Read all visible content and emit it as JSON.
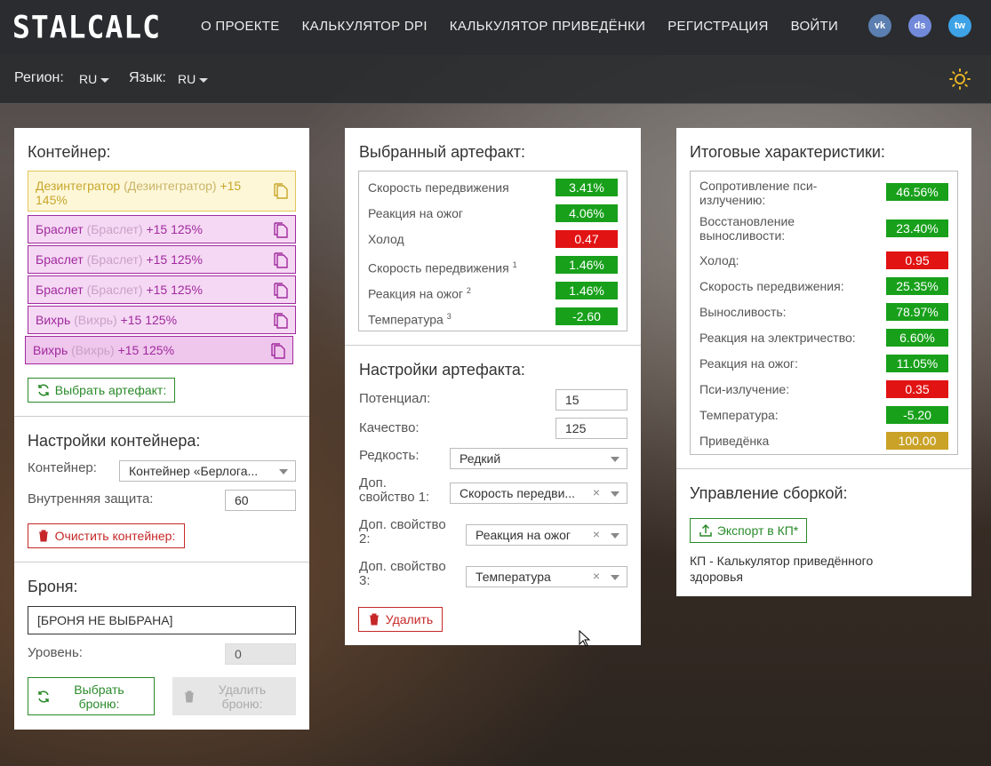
{
  "nav": {
    "logo": "STALCALC",
    "links": [
      "О ПРОЕКТЕ",
      "КАЛЬКУЛЯТОР DPI",
      "КАЛЬКУЛЯТОР ПРИВЕДЁНКИ",
      "РЕГИСТРАЦИЯ",
      "ВОЙТИ"
    ],
    "social": [
      {
        "icon": "vk-icon",
        "text": "vk",
        "color": "#5b7fb0"
      },
      {
        "icon": "discord-icon",
        "text": "ds",
        "color": "#7289da"
      },
      {
        "icon": "twitter-icon",
        "text": "tw",
        "color": "#3da2e6"
      }
    ]
  },
  "subbar": {
    "region_label": "Регион:",
    "region_value": "RU",
    "lang_label": "Язык:",
    "lang_value": "RU",
    "theme_icon": "sun-icon"
  },
  "container_panel": {
    "title": "Контейнер:",
    "artifacts": [
      {
        "name": "Дезинтегратор",
        "type": "(Дезинтегратор)",
        "level": "+15",
        "quality": "145%",
        "style": "legend"
      },
      {
        "name": "Браслет",
        "type": "(Браслет)",
        "level": "+15",
        "quality": "125%",
        "style": "purple"
      },
      {
        "name": "Браслет",
        "type": "(Браслет)",
        "level": "+15",
        "quality": "125%",
        "style": "purple"
      },
      {
        "name": "Браслет",
        "type": "(Браслет)",
        "level": "+15",
        "quality": "125%",
        "style": "purple"
      },
      {
        "name": "Вихрь",
        "type": "(Вихрь)",
        "level": "+15",
        "quality": "125%",
        "style": "purple"
      },
      {
        "name": "Вихрь",
        "type": "(Вихрь)",
        "level": "+15",
        "quality": "125%",
        "style": "purple"
      }
    ],
    "choose_btn": "Выбрать артефакт:",
    "settings_title": "Настройки контейнера:",
    "container_label": "Контейнер:",
    "container_value": "Контейнер «Берлога...",
    "protection_label": "Внутренняя защита:",
    "protection_value": "60",
    "clear_btn": "Очистить контейнер:",
    "armor_title": "Броня:",
    "armor_value": "[БРОНЯ НЕ ВЫБРАНА]",
    "level_label": "Уровень:",
    "level_value": "0",
    "choose_armor_btn": [
      "Выбрать",
      "броню:"
    ],
    "remove_armor_btn": [
      "Удалить",
      "броню:"
    ]
  },
  "artifact_panel": {
    "title": "Выбранный артефакт:",
    "stats": [
      {
        "label": "Скорость передвижения",
        "sup": "",
        "value": "3.41%",
        "color": "g"
      },
      {
        "label": "Реакция на ожог",
        "sup": "",
        "value": "4.06%",
        "color": "g"
      },
      {
        "label": "Холод",
        "sup": "",
        "value": "0.47",
        "color": "r"
      },
      {
        "label": "Скорость передвижения",
        "sup": "1",
        "value": "1.46%",
        "color": "g"
      },
      {
        "label": "Реакция на ожог",
        "sup": "2",
        "value": "1.46%",
        "color": "g"
      },
      {
        "label": "Температура",
        "sup": "3",
        "value": "-2.60",
        "color": "g"
      }
    ],
    "settings_title": "Настройки артефакта:",
    "potential_label": "Потенциал:",
    "potential_value": "15",
    "quality_label": "Качество:",
    "quality_value": "125",
    "rarity_label": "Редкость:",
    "rarity_value": "Редкий",
    "prop1_label": [
      "Доп.",
      "свойство 1:"
    ],
    "prop1_value": "Скорость передви...",
    "prop2_label": [
      "Доп. свойство",
      "2:"
    ],
    "prop2_value": "Реакция на ожог",
    "prop3_label": [
      "Доп. свойство",
      "3:"
    ],
    "prop3_value": "Температура",
    "delete_btn": "Удалить"
  },
  "result_panel": {
    "title": "Итоговые характеристики:",
    "stats": [
      {
        "label": "Сопротивление пси-излучению:",
        "value": "46.56%",
        "color": "g"
      },
      {
        "label": "Восстановление выносливости:",
        "value": "23.40%",
        "color": "g"
      },
      {
        "label": "Холод:",
        "value": "0.95",
        "color": "r"
      },
      {
        "label": "Скорость передвижения:",
        "value": "25.35%",
        "color": "g"
      },
      {
        "label": "Выносливость:",
        "value": "78.97%",
        "color": "g"
      },
      {
        "label": "Реакция на электричество:",
        "value": "6.60%",
        "color": "g"
      },
      {
        "label": "Реакция на ожог:",
        "value": "11.05%",
        "color": "g"
      },
      {
        "label": "Пси-излучение:",
        "value": "0.35",
        "color": "r"
      },
      {
        "label": "Температура:",
        "value": "-5.20",
        "color": "g"
      },
      {
        "label": "Приведёнка",
        "value": "100.00",
        "color": "y"
      }
    ],
    "build_title": "Управление сборкой:",
    "export_btn": "Экспорт в КП*",
    "footnote": "КП - Калькулятор приведённого здоровья"
  }
}
